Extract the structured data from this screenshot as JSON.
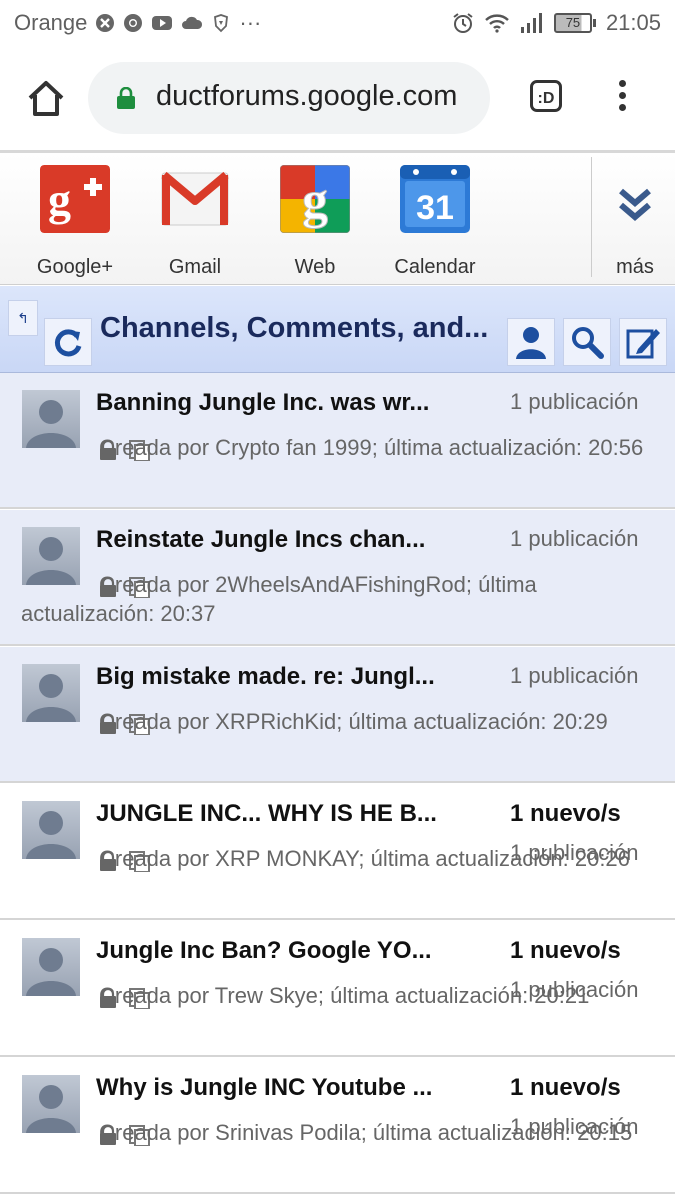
{
  "status_bar": {
    "carrier": "Orange",
    "more": "···",
    "battery": "75",
    "time": "21:05"
  },
  "browser": {
    "url": "ductforums.google.com",
    "tabs_label": ":D"
  },
  "apps": [
    {
      "label": "Google+",
      "icon": "google-plus-icon"
    },
    {
      "label": "Gmail",
      "icon": "gmail-icon"
    },
    {
      "label": "Web",
      "icon": "google-web-icon"
    },
    {
      "label": "Calendar",
      "icon": "calendar-icon",
      "badge": "31"
    }
  ],
  "more_label": "más",
  "forum": {
    "back_label": "↰",
    "title": "Channels, Comments, and..."
  },
  "threads": [
    {
      "title": "Banning Jungle Inc. was wr...",
      "new_label": "",
      "posts": "1 publicación",
      "meta": "Creada por Crypto fan 1999; última actualización: 20:56",
      "state": "read"
    },
    {
      "title": "Reinstate Jungle Incs chan...",
      "new_label": "",
      "posts": "1 publicación",
      "meta": "Creada por 2WheelsAndAFishingRod; última actualización: 20:37",
      "state": "read"
    },
    {
      "title": "Big mistake made. re: Jungl...",
      "new_label": "",
      "posts": "1 publicación",
      "meta": "Creada por XRPRichKid; última actualización: 20:29",
      "state": "read"
    },
    {
      "title": "JUNGLE INC... WHY IS HE B...",
      "new_label": "1 nuevo/s",
      "posts": "1 publicación",
      "meta": "Creada por XRP MONKAY; última actualización: 20:26",
      "state": "new"
    },
    {
      "title": "Jungle Inc Ban? Google YO...",
      "new_label": "1 nuevo/s",
      "posts": "1 publicación",
      "meta": "Creada por Trew Skye; última actualización: 20:21",
      "state": "new"
    },
    {
      "title": "Why is Jungle INC Youtube ...",
      "new_label": "1 nuevo/s",
      "posts": "1 publicación",
      "meta": "Creada por Srinivas Podila; última actualización: 20:15",
      "state": "new"
    }
  ]
}
